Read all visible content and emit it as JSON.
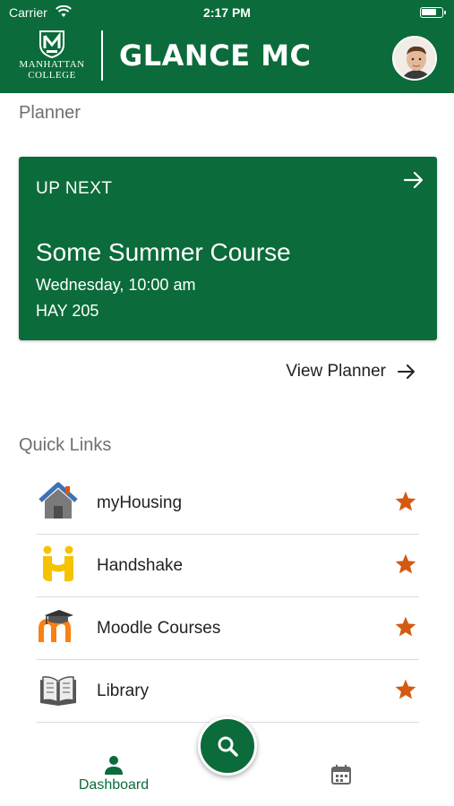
{
  "status_bar": {
    "carrier": "Carrier",
    "time": "2:17 PM",
    "battery_level": 0.75
  },
  "header": {
    "college_name_line1": "MANHATTAN",
    "college_name_line2": "COLLEGE",
    "app_title": "GLANCE MC",
    "brand_color": "#0b6b3a"
  },
  "planner": {
    "section_title": "Planner",
    "card": {
      "eyebrow": "UP NEXT",
      "course": "Some Summer Course",
      "time": "Wednesday, 10:00 am",
      "room": "HAY 205"
    },
    "view_planner_label": "View Planner"
  },
  "quick_links": {
    "section_title": "Quick Links",
    "items": [
      {
        "label": "myHousing",
        "icon": "house-icon",
        "favorite": true
      },
      {
        "label": "Handshake",
        "icon": "handshake-icon",
        "favorite": true
      },
      {
        "label": "Moodle Courses",
        "icon": "moodle-icon",
        "favorite": true
      },
      {
        "label": "Library",
        "icon": "book-icon",
        "favorite": true
      }
    ],
    "star_color": "#d35a10"
  },
  "tab_bar": {
    "dashboard_label": "Dashboard",
    "active_tab": "Dashboard"
  }
}
